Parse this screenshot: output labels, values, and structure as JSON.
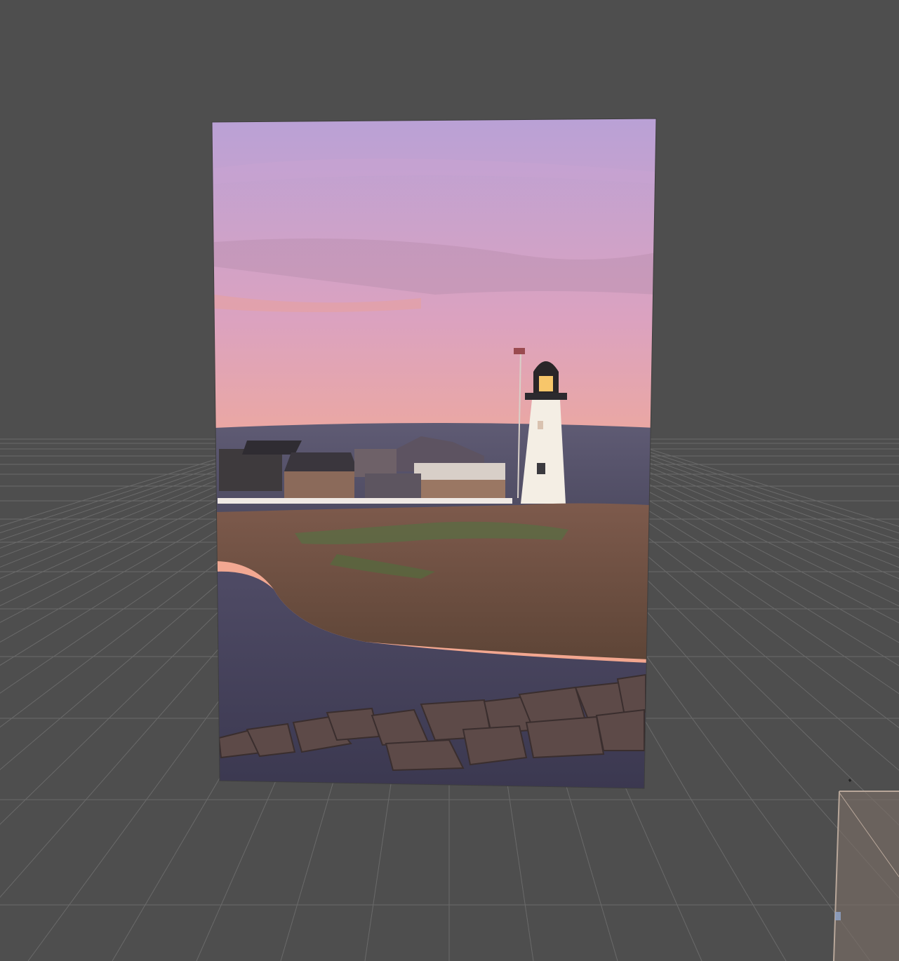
{
  "viewport": {
    "background": "#4e4e4e",
    "grid_color": "#6a6a6a",
    "grid_visible": true
  },
  "photo_plane": {
    "subject": "lighthouse-at-sunset",
    "colors": {
      "sky_top": "#b9a1d6",
      "sky_mid": "#e8a3a8",
      "sky_low": "#f2a98b",
      "sea": "#5c5a70",
      "land": "#7a5b4b",
      "rocks": "#6a4d43",
      "lighthouse": "#f4eee4",
      "lantern": "#f7c66a"
    }
  },
  "corner_object": {
    "kind": "box-wireframe",
    "color": "#b8a79a"
  }
}
